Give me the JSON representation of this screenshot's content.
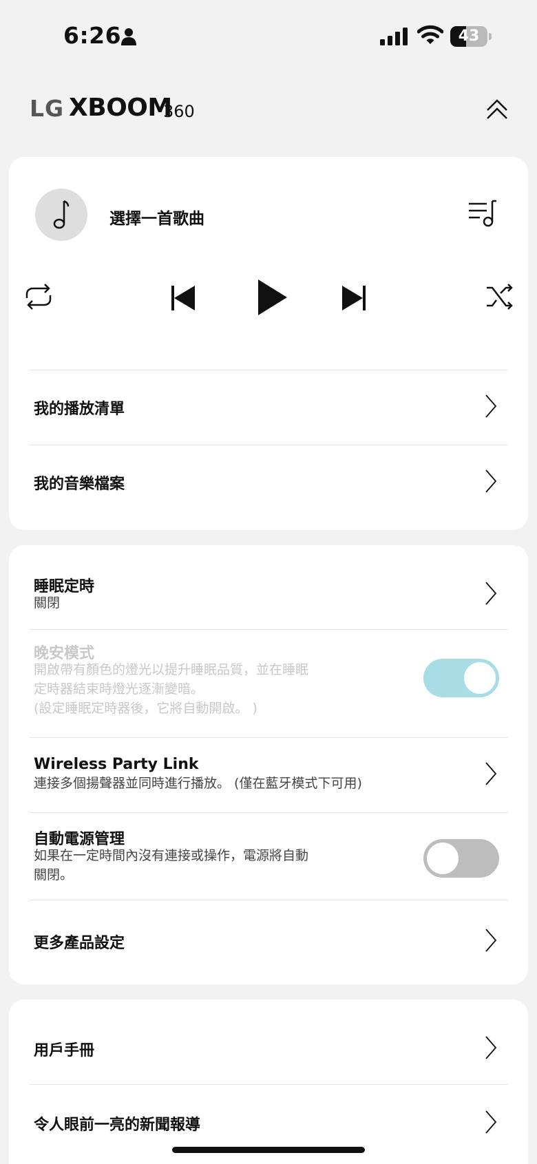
{
  "status_bar": {
    "time": "6:26",
    "battery_level": "43",
    "icons": [
      "person-icon",
      "signal-icon",
      "wifi-icon",
      "battery-icon"
    ]
  },
  "header": {
    "brand_lg": "LG",
    "brand_name": "XBOOM",
    "brand_model": "360",
    "collapse_icon": "double-chevron-up-icon"
  },
  "player": {
    "song_title": "選擇一首歌曲",
    "icons": [
      "music-note-icon",
      "playlist-queue-icon",
      "repeat-icon",
      "skip-previous-icon",
      "play-icon",
      "skip-next-icon",
      "shuffle-icon"
    ],
    "menu": [
      {
        "label": "我的播放清單"
      },
      {
        "label": "我的音樂檔案"
      }
    ]
  },
  "settings": {
    "sleep_timer": {
      "title": "睡眠定時",
      "value": "關閉"
    },
    "goodnight_mode": {
      "title": "晚安模式",
      "description": [
        "開啟帶有顏色的燈光以提升睡眠品質，並在睡眠",
        "定時器結束時燈光逐漸變暗。",
        "(設定睡眠定時器後，它將自動開啟。 )"
      ],
      "enabled": true
    },
    "wireless_party_link": {
      "title": "Wireless Party Link",
      "description": "連接多個揚聲器並同時進行播放。 (僅在藍牙模式下可用)"
    },
    "auto_power": {
      "title": "自動電源管理",
      "description": [
        "如果在一定時間內沒有連接或操作，電源將自動",
        "關閉。"
      ],
      "enabled": false
    },
    "more_settings": {
      "title": "更多產品設定"
    }
  },
  "links": {
    "items": [
      {
        "label": "用戶手冊"
      },
      {
        "label": "令人眼前一亮的新聞報導"
      }
    ]
  },
  "colors": {
    "background": "#f2f2f2",
    "card": "#ffffff",
    "toggle_on": "#a8dde5",
    "toggle_off": "#bdbdbd",
    "disabled_text": "#c8c8c8"
  }
}
